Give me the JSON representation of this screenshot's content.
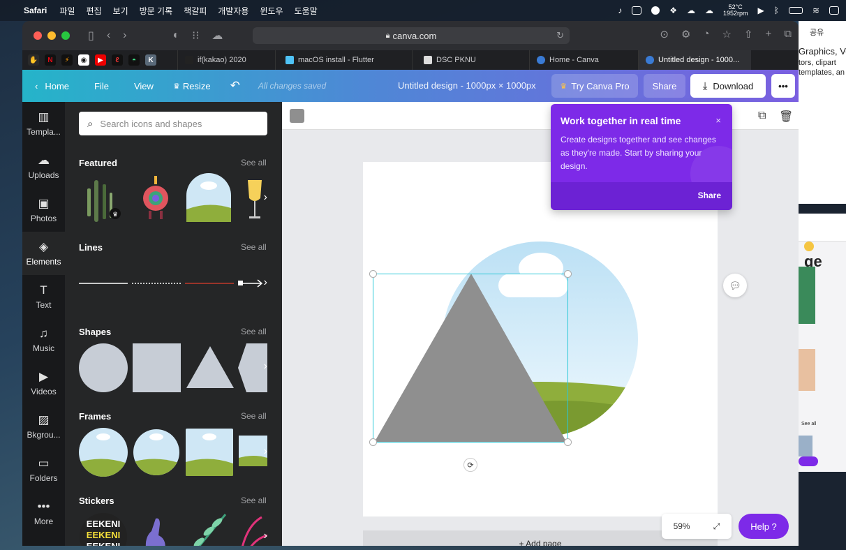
{
  "menubar": {
    "app": "Safari",
    "items": [
      "파일",
      "편집",
      "보기",
      "방문 기록",
      "책갈피",
      "개발자용",
      "윈도우",
      "도움말"
    ],
    "temp": "52°C",
    "rpm": "1952rpm"
  },
  "browser": {
    "url": "canva.com",
    "tabs": [
      {
        "label": "if(kakao) 2020",
        "color": "#222"
      },
      {
        "label": "macOS install - Flutter",
        "color": "#4fc3f7"
      },
      {
        "label": "DSC PKNU",
        "color": "#ddd"
      },
      {
        "label": "Home - Canva",
        "color": "#3a7bd5"
      },
      {
        "label": "Untitled design - 1000...",
        "color": "#3a7bd5"
      }
    ]
  },
  "header": {
    "home": "Home",
    "file": "File",
    "view": "View",
    "resize": "Resize",
    "saved": "All changes saved",
    "title": "Untitled design - 1000px × 1000px",
    "try_pro": "Try Canva Pro",
    "share": "Share",
    "download": "Download",
    "more": "•••"
  },
  "sidenav": [
    {
      "label": "Templa...",
      "icon": "▥"
    },
    {
      "label": "Uploads",
      "icon": "☁"
    },
    {
      "label": "Photos",
      "icon": "▣"
    },
    {
      "label": "Elements",
      "icon": "◈"
    },
    {
      "label": "Text",
      "icon": "T"
    },
    {
      "label": "Music",
      "icon": "♫"
    },
    {
      "label": "Videos",
      "icon": "▶"
    },
    {
      "label": "Bkgrou...",
      "icon": "▨"
    },
    {
      "label": "Folders",
      "icon": "▭"
    },
    {
      "label": "More",
      "icon": "•••"
    }
  ],
  "panel": {
    "search_placeholder": "Search icons and shapes",
    "see_all": "See all",
    "sections": [
      "Featured",
      "Lines",
      "Shapes",
      "Frames",
      "Stickers"
    ],
    "sticker_text": "EEKENI"
  },
  "popover": {
    "title": "Work together in real time",
    "body": "Create designs together and see changes as they're made. Start by sharing your design.",
    "share": "Share",
    "close": "×"
  },
  "canvas": {
    "add_page": "+ Add page",
    "zoom": "59%",
    "help": "Help ?"
  },
  "bg_right": {
    "share": "공유",
    "heading": "Graphics, Ve",
    "line1": "tors, clipart",
    "line2": "templates, an",
    "big": "ge",
    "see_all": "See all"
  }
}
